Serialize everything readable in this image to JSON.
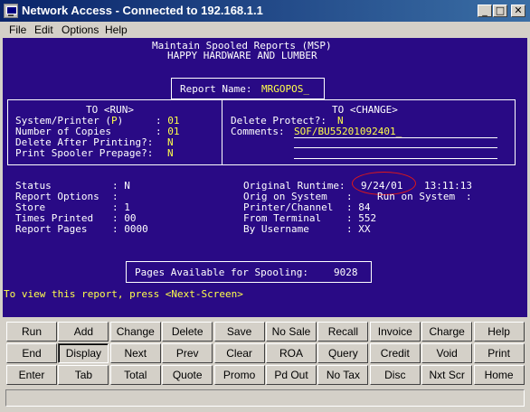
{
  "window": {
    "title": "Network Access - Connected to 192.168.1.1",
    "controls": {
      "minimize": "_",
      "maximize": "□",
      "close": "✕"
    }
  },
  "menu": [
    "File",
    "Edit",
    "Options",
    "Help"
  ],
  "screen": {
    "header1": "Maintain Spooled Reports (MSP)",
    "header2": "HAPPY HARDWARE AND LUMBER",
    "report_name_label": "Report Name:",
    "report_name_value": "MRGOPOS_",
    "run": {
      "title": "TO <RUN>",
      "system_printer_label": "System/Printer (",
      "system_printer_p": "P",
      "system_printer_close": ")",
      "system_printer_value": ": 01",
      "copies_label": "Number of Copies",
      "copies_value": ": 01",
      "delete_after_label": "Delete After Printing?:",
      "delete_after_value": "N",
      "prepage_label": "Print Spooler Prepage?:",
      "prepage_value": "N"
    },
    "change": {
      "title": "TO <CHANGE>",
      "delete_protect_label": "Delete Protect?:",
      "delete_protect_value": "N",
      "comments_label": "Comments:",
      "comments_value": "SOF/BU55201092401_"
    },
    "status": {
      "status_label": "Status",
      "status_value": ": N",
      "options_label": "Report Options",
      "options_value": ":",
      "store_label": "Store",
      "store_value": ": 1",
      "times_printed_label": "Times Printed",
      "times_printed_value": ": 00",
      "pages_label": "Report Pages",
      "pages_value": ": 0000"
    },
    "runtime": {
      "original_label": "Original Runtime:",
      "date": "9/24/01",
      "time": "13:11:13",
      "orig_system_label": "Orig on System",
      "orig_system_value": ":",
      "run_system_label": "Run on System",
      "run_system_value": ":",
      "printer_channel_label": "Printer/Channel",
      "printer_channel_value": ": 84",
      "from_terminal_label": "From Terminal",
      "from_terminal_value": ": 552",
      "by_username_label": "By Username",
      "by_username_value": ": XX"
    },
    "pages_available_label": "Pages Available for Spooling:",
    "pages_available_value": "9028",
    "prompt": "To view this report, press <Next-Screen>"
  },
  "buttons": {
    "row1": [
      "Run",
      "Add",
      "Change",
      "Delete",
      "Save",
      "No Sale",
      "Recall",
      "Invoice",
      "Charge",
      "Help"
    ],
    "row2": [
      "End",
      "Display",
      "Next",
      "Prev",
      "Clear",
      "ROA",
      "Query",
      "Credit",
      "Void",
      "Print"
    ],
    "row3": [
      "Enter",
      "Tab",
      "Total",
      "Quote",
      "Promo",
      "Pd Out",
      "No Tax",
      "Disc",
      "Nxt Scr",
      "Home"
    ],
    "pressed": "Display"
  },
  "colors": {
    "terminal_bg": "#290a85",
    "terminal_text": "#ffffff",
    "highlight_text": "#ffff4a",
    "annotation": "#e01818",
    "titlebar_start": "#0a246a"
  }
}
